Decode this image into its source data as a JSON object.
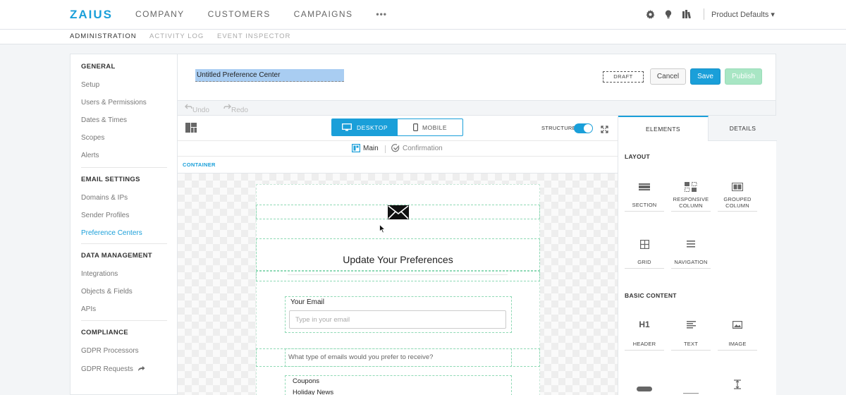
{
  "header": {
    "logo": "ZAIUS",
    "nav": [
      "COMPANY",
      "CUSTOMERS",
      "CAMPAIGNS"
    ],
    "more": "•••",
    "account": "Product Defaults ▾"
  },
  "subnav": {
    "items": [
      "ADMINISTRATION",
      "ACTIVITY LOG",
      "EVENT INSPECTOR"
    ]
  },
  "sidebar": {
    "general": "GENERAL",
    "general_items": [
      "Setup",
      "Users & Permissions",
      "Dates & Times",
      "Scopes",
      "Alerts"
    ],
    "email": "EMAIL SETTINGS",
    "email_items": [
      "Domains & IPs",
      "Sender Profiles",
      "Preference Centers"
    ],
    "data": "DATA MANAGEMENT",
    "data_items": [
      "Integrations",
      "Objects & Fields",
      "APIs"
    ],
    "compliance": "COMPLIANCE",
    "compliance_items": [
      "GDPR Processors",
      "GDPR Requests"
    ]
  },
  "editor": {
    "title": "Untitled Preference Center",
    "draft": "DRAFT",
    "cancel": "Cancel",
    "save": "Save",
    "publish": "Publish",
    "undo": "Undo",
    "redo": "Redo",
    "desktop": "DESKTOP",
    "mobile": "MOBILE",
    "structure": "STRUCTURE",
    "page_main": "Main",
    "page_confirmation": "Confirmation",
    "container": "CONTAINER"
  },
  "preview": {
    "heading": "Update Your Preferences",
    "email_label": "Your Email",
    "email_placeholder": "Type in your email",
    "question": "What type of emails would you prefer to receive?",
    "options": [
      "Coupons",
      "Holiday News"
    ]
  },
  "elements_panel": {
    "tab_elements": "ELEMENTS",
    "tab_details": "DETAILS",
    "layout_title": "LAYOUT",
    "layout_tiles": [
      "SECTION",
      "RESPONSIVE COLUMN",
      "GROUPED COLUMN",
      "GRID",
      "NAVIGATION"
    ],
    "basic_title": "BASIC CONTENT",
    "basic_tiles": [
      "HEADER",
      "TEXT",
      "IMAGE"
    ],
    "h1_glyph": "H1"
  },
  "colors": {
    "accent": "#1a9fd9",
    "publish": "#a8e6c4",
    "selection": "#a9cdf2"
  }
}
